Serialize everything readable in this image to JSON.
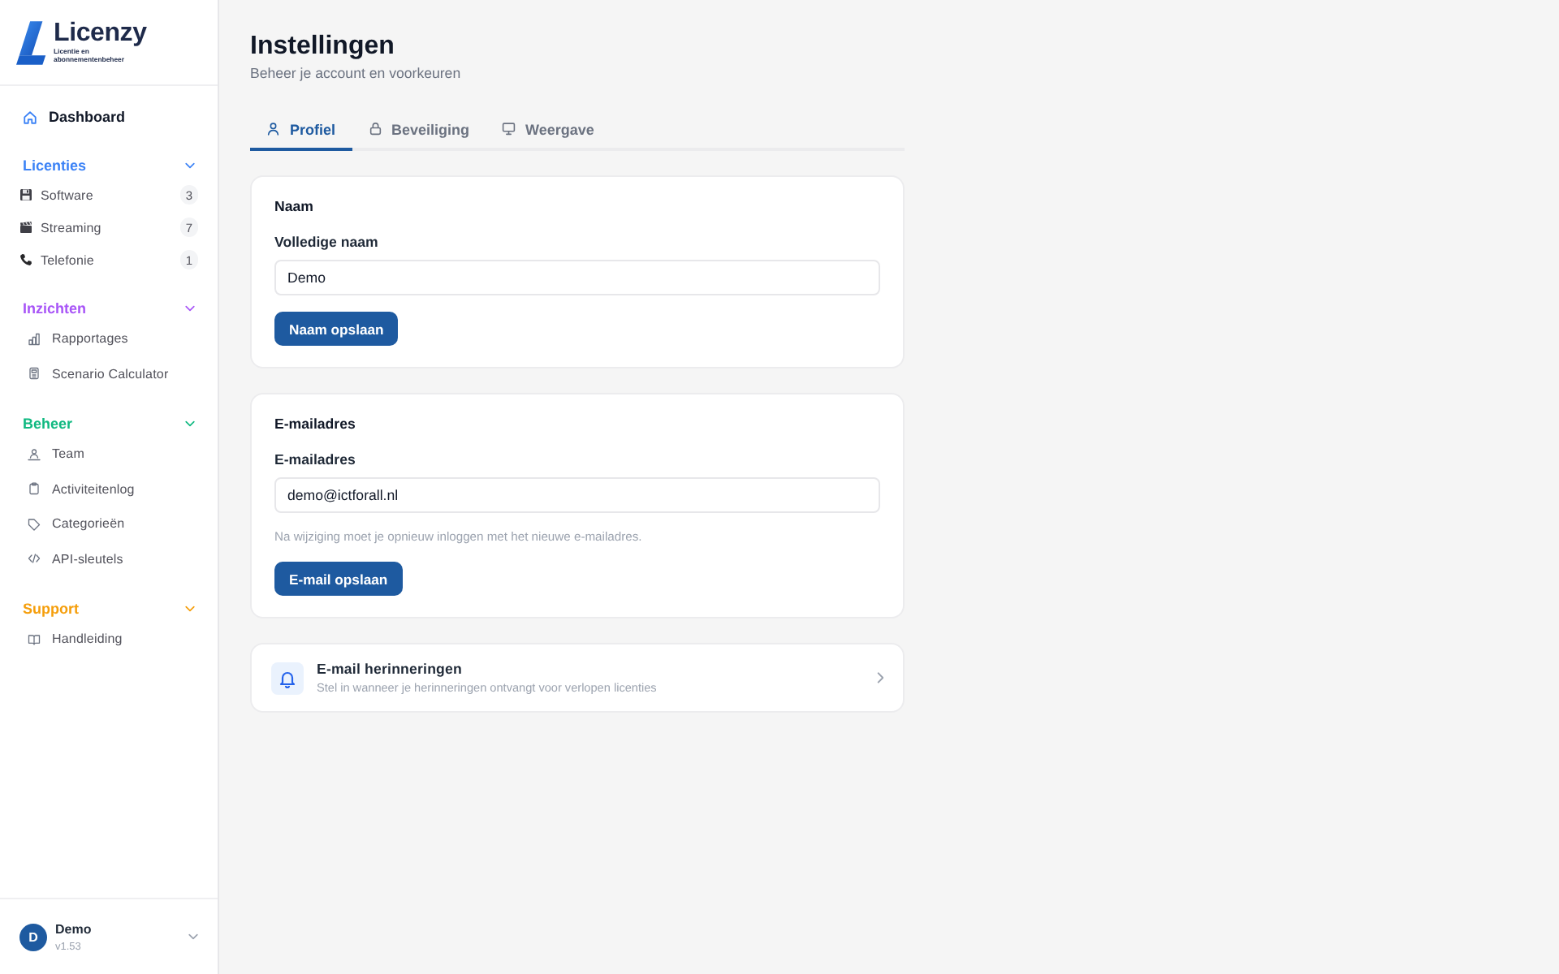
{
  "sidebar": {
    "logo": {
      "name": "Licenzy",
      "tagline": [
        "Licentie en",
        "abonnementenbeheer"
      ]
    },
    "top_items": [
      {
        "label": "Dashboard"
      }
    ],
    "sections": [
      {
        "title": "Licenties",
        "color": "#3b82f6",
        "expanded": true,
        "items": [
          {
            "label": "Software",
            "count": "3"
          },
          {
            "label": "Streaming",
            "count": "7"
          },
          {
            "label": "Telefonie",
            "count": "1"
          }
        ]
      },
      {
        "title": "Inzichten",
        "color": "#a855f7",
        "expanded": true,
        "items": [
          {
            "label": "Rapportages"
          },
          {
            "label": "Scenario Calculator"
          }
        ]
      },
      {
        "title": "Beheer",
        "color": "#10b981",
        "expanded": true,
        "items": [
          {
            "label": "Team"
          },
          {
            "label": "Activiteitenlog"
          },
          {
            "label": "Categorieën"
          },
          {
            "label": "API-sleutels"
          }
        ]
      },
      {
        "title": "Support",
        "color": "#f59e0b",
        "expanded": true,
        "items": [
          {
            "label": "Handleiding"
          }
        ]
      }
    ],
    "user": {
      "initial": "D",
      "name": "Demo",
      "version": "v1.53"
    }
  },
  "page": {
    "title": "Instellingen",
    "subtitle": "Beheer je account en voorkeuren"
  },
  "tabs": [
    {
      "label": "Profiel",
      "selected": true
    },
    {
      "label": "Beveiliging",
      "selected": false
    },
    {
      "label": "Weergave",
      "selected": false
    }
  ],
  "name_card": {
    "title": "Naam",
    "field_label": "Volledige naam",
    "value": "Demo",
    "button": "Naam opslaan"
  },
  "email_card": {
    "title": "E-mailadres",
    "field_label": "E-mailadres",
    "value": "demo@ictforall.nl",
    "hint": "Na wijziging moet je opnieuw inloggen met het nieuwe e-mailadres.",
    "button": "E-mail opslaan"
  },
  "reminder_card": {
    "title": "E-mail herinneringen",
    "subtitle": "Stel in wanneer je herinneringen ontvangt voor verlopen licenties"
  }
}
